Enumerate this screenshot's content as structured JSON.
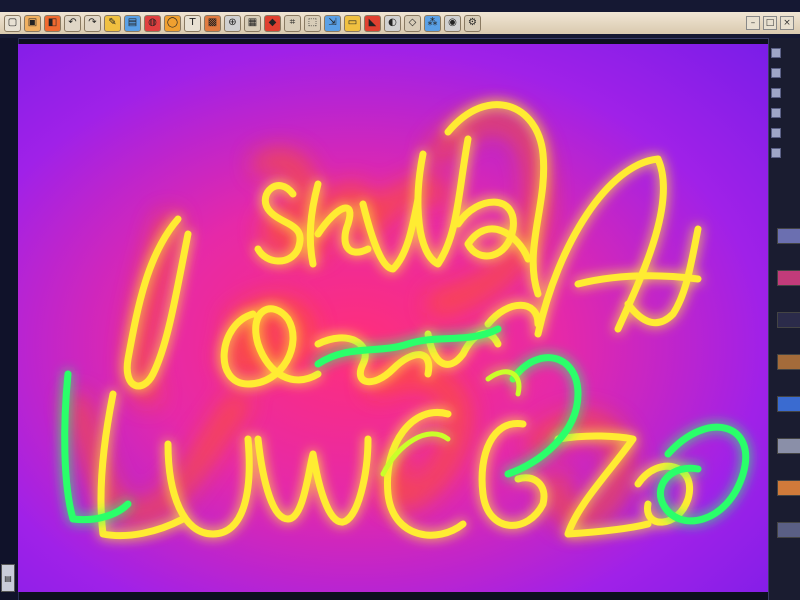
{
  "toolbar": {
    "buttons": [
      {
        "name": "new-file-icon",
        "glyph": "▢",
        "color": "#e8e1d3"
      },
      {
        "name": "open-folder-icon",
        "glyph": "▣",
        "color": "#f0b060"
      },
      {
        "name": "save-icon",
        "glyph": "◧",
        "color": "#f06a30"
      },
      {
        "name": "undo-icon",
        "glyph": "↶",
        "color": "#e0d6c6"
      },
      {
        "name": "redo-icon",
        "glyph": "↷",
        "color": "#e0d6c6"
      },
      {
        "name": "brush-icon",
        "glyph": "✎",
        "color": "#f0c040"
      },
      {
        "name": "layers-icon",
        "glyph": "▤",
        "color": "#5aa0e6"
      },
      {
        "name": "palette-icon",
        "glyph": "◍",
        "color": "#e04040"
      },
      {
        "name": "circle-icon",
        "glyph": "◯",
        "color": "#f0a030"
      },
      {
        "name": "text-icon",
        "glyph": "T",
        "color": "#e8e1d3"
      },
      {
        "name": "image-icon",
        "glyph": "▩",
        "color": "#e07a40"
      },
      {
        "name": "zoom-icon",
        "glyph": "⊕",
        "color": "#d0d0d0"
      },
      {
        "name": "grid-icon",
        "glyph": "▦",
        "color": "#d8cdb8"
      },
      {
        "name": "stamp-icon",
        "glyph": "◆",
        "color": "#e04030"
      },
      {
        "name": "crop-icon",
        "glyph": "⌗",
        "color": "#d8cdb8"
      },
      {
        "name": "select-icon",
        "glyph": "⬚",
        "color": "#d8cdb8"
      },
      {
        "name": "transform-icon",
        "glyph": "⇲",
        "color": "#5aa0e6"
      },
      {
        "name": "eraser-icon",
        "glyph": "▭",
        "color": "#f0c040"
      },
      {
        "name": "fill-icon",
        "glyph": "◣",
        "color": "#e04030"
      },
      {
        "name": "gradient-icon",
        "glyph": "◐",
        "color": "#d0d0d0"
      },
      {
        "name": "shape-icon",
        "glyph": "◇",
        "color": "#d8cdb8"
      },
      {
        "name": "picker-icon",
        "glyph": "⁂",
        "color": "#5aa0e6"
      },
      {
        "name": "filter-icon",
        "glyph": "◉",
        "color": "#d0d0d0"
      },
      {
        "name": "settings-icon",
        "glyph": "⚙",
        "color": "#d8cdb8"
      }
    ],
    "window_controls": [
      {
        "name": "minimize-icon",
        "glyph": "–"
      },
      {
        "name": "maximize-icon",
        "glyph": "□"
      },
      {
        "name": "close-icon",
        "glyph": "×"
      }
    ]
  },
  "canvas": {
    "background_colors": [
      "#ff2f7a",
      "#e629a8",
      "#a021e8",
      "#7a1de8"
    ],
    "stroke_colors": {
      "yellow": "#ffec33",
      "orange_glow": "#ff5a1e",
      "green": "#2bff6a",
      "lime": "#caff2b"
    }
  },
  "left_panel": {
    "corner_icon": "layer-thumbnail-icon"
  },
  "right_panel": {
    "tools": [
      "brush-size-icon",
      "opacity-icon",
      "flow-icon",
      "hardness-icon",
      "spacing-icon",
      "angle-icon"
    ]
  }
}
